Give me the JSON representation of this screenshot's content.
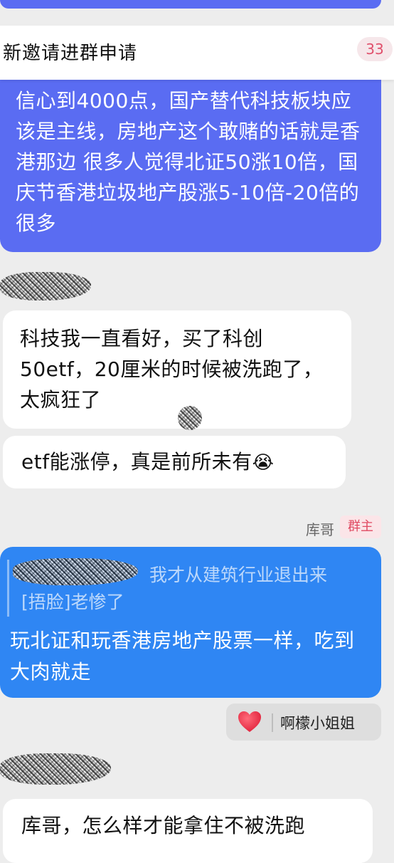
{
  "notification": {
    "text": "新邀请进群申请",
    "count": "33"
  },
  "messages": {
    "purple_text": "信心到4000点，国产替代科技板块应该是主线，房地产这个敢赌的话就是香港那边 很多人觉得北证50涨10倍，国庆节香港垃圾地产股涨5-10倍-20倍的很多",
    "white1_text": "科技我一直看好，买了科创50etf，20厘米的时候被洗跑了，太疯狂了",
    "white2_text": "etf能涨停，真是前所未有",
    "white2_emoji": "😭",
    "owner_name": "库哥",
    "owner_tag": "群主",
    "quote_line1": "我才从建筑行业退出来",
    "quote_line2": "[捂脸]老惨了",
    "reply_text": "玩北证和玩香港房地产股票一样，吃到大肉就走",
    "reaction_emoji": "heart-icon",
    "reaction_user": "啊檬小姐姐",
    "last_text": "库哥，怎么样才能拿住不被洗跑"
  },
  "colors": {
    "purple_bubble": "#5a6cf2",
    "blue_bubble": "#2f86f3",
    "background": "#ededed",
    "badge_text": "#e0506c"
  }
}
